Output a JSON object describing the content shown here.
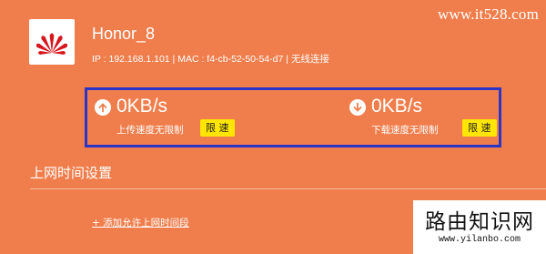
{
  "watermark": {
    "site": "www.it528.com"
  },
  "device": {
    "name": "Honor_8",
    "info": "IP : 192.168.1.101 | MAC : f4-cb-52-50-54-d7 | 无线连接",
    "logo_icon": "huawei-logo-icon"
  },
  "upload": {
    "speed": "0KB/s",
    "label": "上传速度无限制",
    "button": "限 速",
    "icon": "arrow-up-icon"
  },
  "download": {
    "speed": "0KB/s",
    "label": "下载速度无限制",
    "button": "限 速",
    "icon": "arrow-down-icon"
  },
  "schedule": {
    "title": "上网时间设置",
    "add_link": "+ 添加允许上网时间段"
  },
  "brand": {
    "title": "路由知识网",
    "url": "www.yilanbo.com"
  },
  "colors": {
    "background": "#f07e4c",
    "highlight_border": "#2a34c6",
    "limit_button": "#ffe600"
  }
}
